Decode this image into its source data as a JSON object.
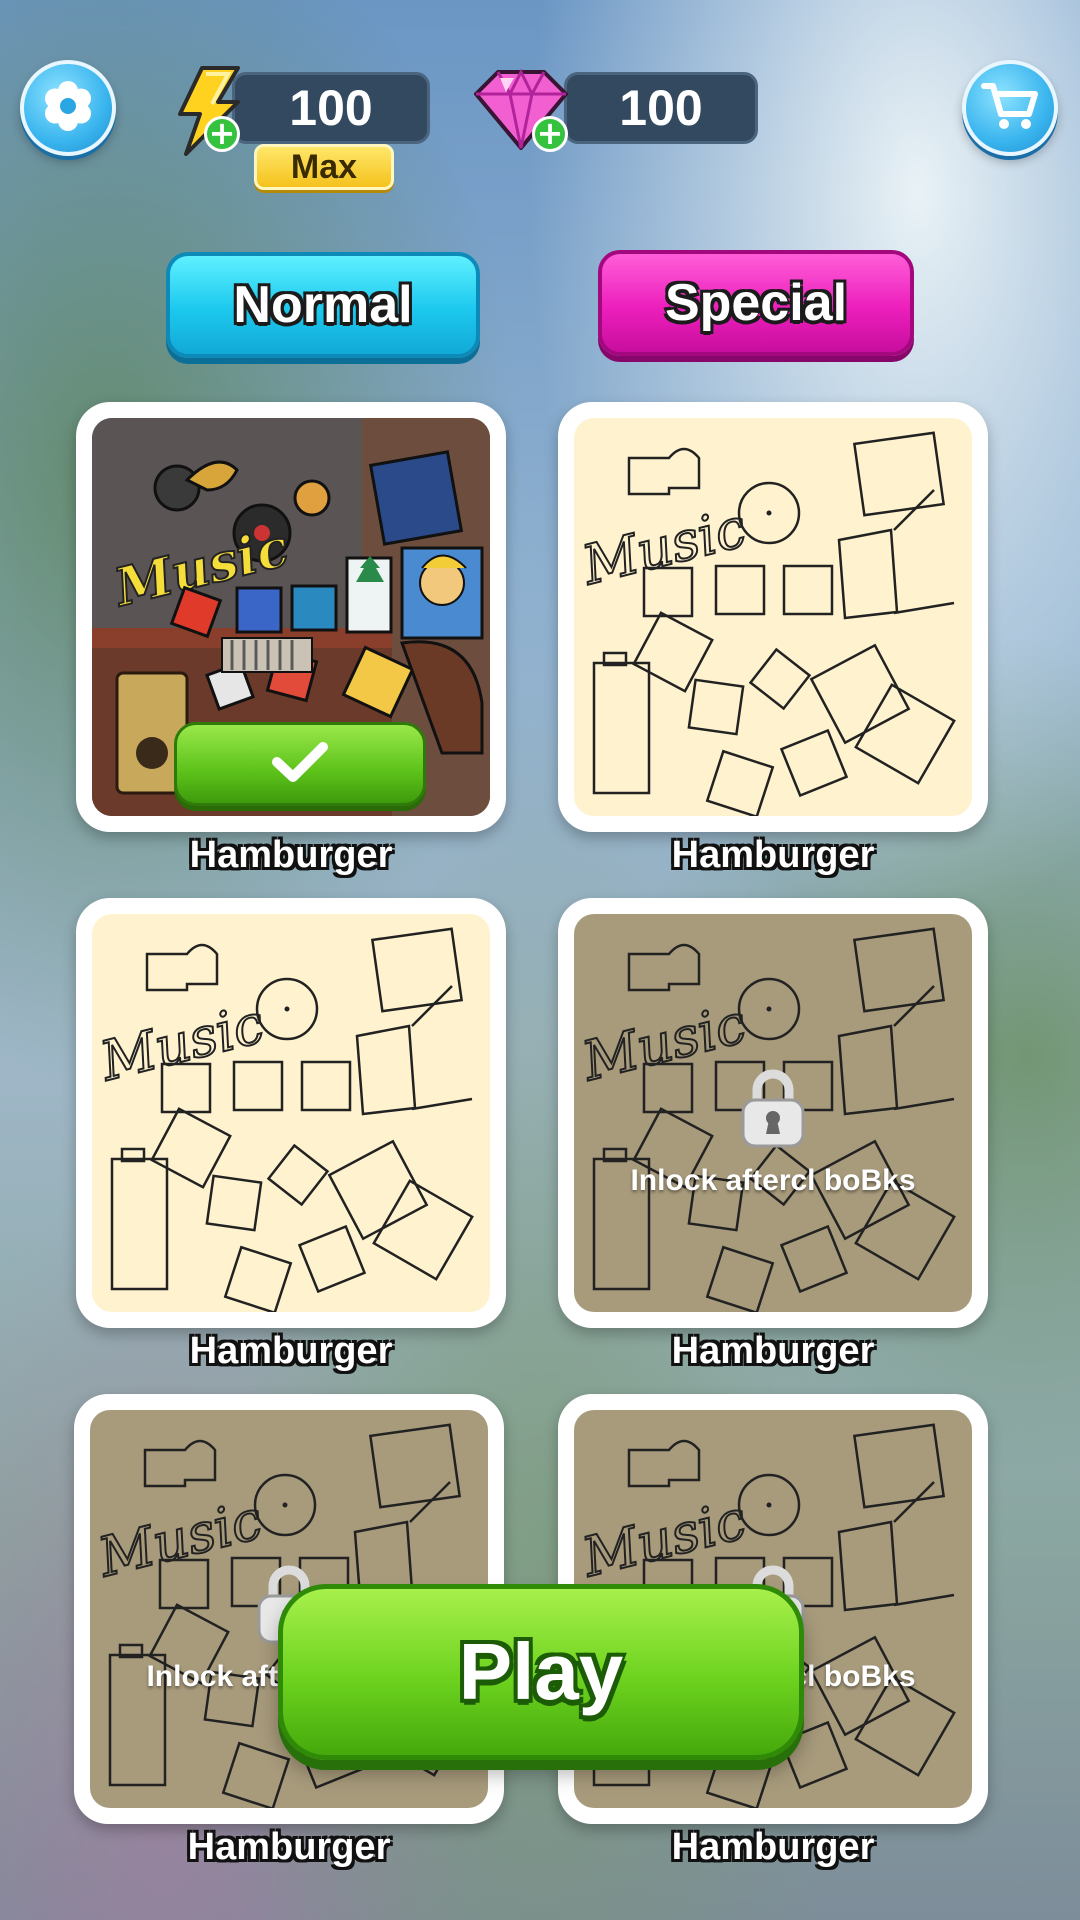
{
  "hud": {
    "settings_icon": "gear-icon",
    "cart_icon": "cart-icon",
    "energy": {
      "value": "100",
      "badge": "Max",
      "icon": "lightning-icon"
    },
    "gems": {
      "value": "100",
      "icon": "gem-icon"
    }
  },
  "modes": {
    "normal_label": "Normal",
    "special_label": "Special"
  },
  "levels": [
    {
      "name": "Hamburger",
      "state": "completed"
    },
    {
      "name": "Hamburger",
      "state": "available"
    },
    {
      "name": "Hamburger",
      "state": "available"
    },
    {
      "name": "Hamburger",
      "state": "locked",
      "lock_text": "Inlock aftercl boBks"
    },
    {
      "name": "Hamburger",
      "state": "locked",
      "lock_text": "Inlock aftercl boBks"
    },
    {
      "name": "Hamburger",
      "state": "locked",
      "lock_text": "Inlock aftercl boBks"
    }
  ],
  "play_label": "Play",
  "colors": {
    "normal": "#1cc8ee",
    "special": "#ec1fbc",
    "play": "#6cd21e",
    "hud_box": "#33495f"
  }
}
